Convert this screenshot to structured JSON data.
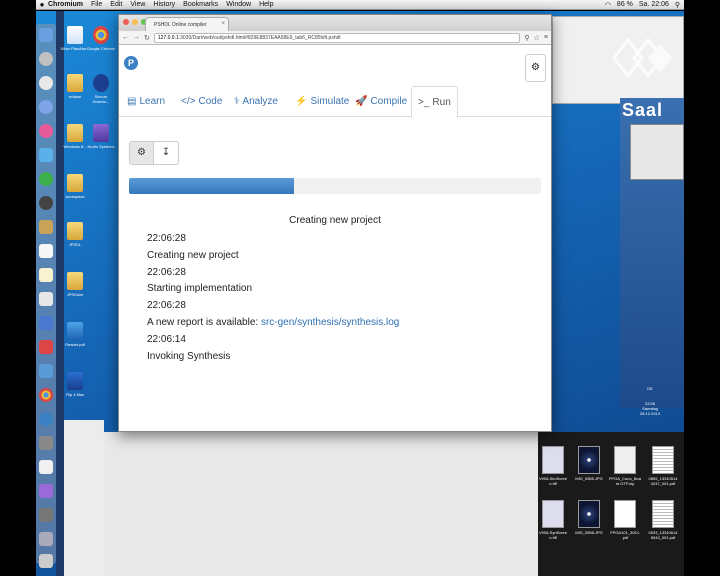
{
  "menubar": {
    "items": [
      "Chromium",
      "File",
      "Edit",
      "View",
      "History",
      "Bookmarks",
      "Window",
      "Help"
    ],
    "battery": "86 %",
    "clock": "Sa. 22:06"
  },
  "desktop_icons": [
    {
      "label": "Xilinx PlanAhe..."
    },
    {
      "label": "Google Chrome"
    },
    {
      "label": "eclipse"
    },
    {
      "label": "Secure Downlo..."
    },
    {
      "label": "Windows 8..."
    },
    {
      "label": "Nudio Systems"
    },
    {
      "label": "workspace"
    },
    {
      "label": "JPSDL"
    },
    {
      "label": "JPSDsim"
    },
    {
      "label": "Reader.pdf"
    },
    {
      "label": "Flip 4 Mac"
    }
  ],
  "right_side": {
    "brand": "Saal",
    "tray_lines": [
      "DE",
      "22:06",
      "Samstag",
      "28.12.2013"
    ]
  },
  "files": [
    {
      "label": "VHDLSimScree n.tiff"
    },
    {
      "label": "IMG_0555.JPG"
    },
    {
      "label": "FPGA_Cono_Boa rd.GTP.zip"
    },
    {
      "label": "0859_13310514 4247_001.pdf"
    },
    {
      "label": "VHDLSynScree n.tiff"
    },
    {
      "label": "IMG_0558.JPG"
    },
    {
      "label": "FPGA101_30CL .pdf"
    },
    {
      "label": "0933_13310614 5043_001.pdf"
    }
  ],
  "browser": {
    "tab_title": "PSHDL Online compiler",
    "url_host": "127.0.0.1",
    "url_rest": ":3030/Dart/web/out/pshdl.html#829E8837EAA58E9_tab6_RC85hift.pshdl"
  },
  "app": {
    "logo_letter": "P",
    "settings_icon": "gear-icon",
    "tabs": [
      {
        "label": "Learn",
        "icon": "book-icon",
        "glyph": "▤"
      },
      {
        "label": "Code",
        "icon": "code-icon",
        "glyph": "</>"
      },
      {
        "label": "Analyze",
        "icon": "stethoscope-icon",
        "glyph": "⚕"
      },
      {
        "label": "Simulate",
        "icon": "bolt-icon",
        "glyph": "⚡"
      },
      {
        "label": "Compile",
        "icon": "rocket-icon",
        "glyph": "🚀"
      },
      {
        "label": "Run",
        "icon": "terminal-icon",
        "glyph": ">_"
      }
    ],
    "active_tab": "Run",
    "progress_fraction": 0.4,
    "status_title": "Creating new project",
    "log": [
      {
        "text": "22:06:28"
      },
      {
        "text": "Creating new project"
      },
      {
        "text": "22:06:28"
      },
      {
        "text": "Starting implementation"
      },
      {
        "text": "22:06:28"
      },
      {
        "text": "A new report is available: ",
        "link": "src-gen/synthesis/synthesis.log"
      },
      {
        "text": "22:06:14"
      },
      {
        "text": "Invoking Synthesis"
      }
    ]
  }
}
